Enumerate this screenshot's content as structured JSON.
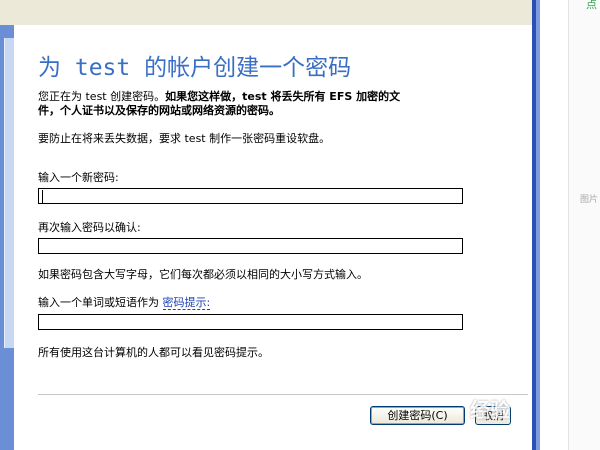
{
  "dialog": {
    "title": "为 test 的帐户创建一个密码",
    "intro_line1_a": "您正在为 test 创建密码。",
    "intro_line1_b": "如果您这样做，test 将丢失所有 EFS 加密的文",
    "intro_line2": "件，个人证书以及保存的网站或网络资源的密码。",
    "reset_note": "要防止在将来丢失数据，要求 test 制作一张密码重设软盘。",
    "new_password_label": "输入一个新密码:",
    "new_password_value": "",
    "confirm_password_label": "再次输入密码以确认:",
    "confirm_password_value": "",
    "case_note": "如果密码包含大写字母，它们每次都必须以相同的大小写方式输入。",
    "hint_label_prefix": "输入一个单词或短语作为",
    "hint_link": "密码提示:",
    "hint_value": "",
    "hint_visibility_note": "所有使用这台计算机的人都可以看见密码提示。"
  },
  "buttons": {
    "create": "创建密码(C)",
    "cancel": "取消"
  },
  "side": {
    "top_fragment": "点",
    "mid_fragment": "图片"
  },
  "watermark": "经验",
  "colors": {
    "title_blue": "#3a6ec6",
    "xp_blue": "#2a4fb5",
    "dialog_bg": "#ffffff"
  }
}
